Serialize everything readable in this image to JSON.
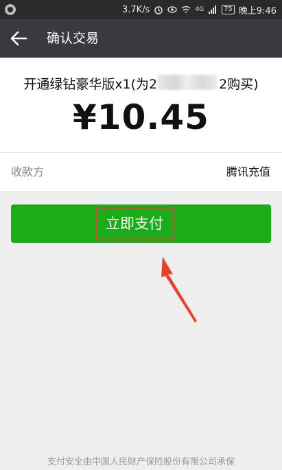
{
  "status_bar": {
    "speed": "3.7K/s",
    "signal": "4G",
    "battery": "75",
    "time": "晚上9:46"
  },
  "header": {
    "title": "确认交易"
  },
  "order": {
    "product_prefix": "开通绿钻豪华版x1(为2",
    "product_suffix": "2购买)",
    "amount": "¥10.45"
  },
  "payee": {
    "label": "收款方",
    "value": "腾讯充值"
  },
  "pay_button": {
    "label": "立即支付"
  },
  "footer": {
    "note": "支付安全由中国人民财产保险股份有限公司承保"
  },
  "colors": {
    "pay_green": "#1aad19",
    "title_bar": "#393a3f",
    "highlight_red": "#d9452f"
  }
}
